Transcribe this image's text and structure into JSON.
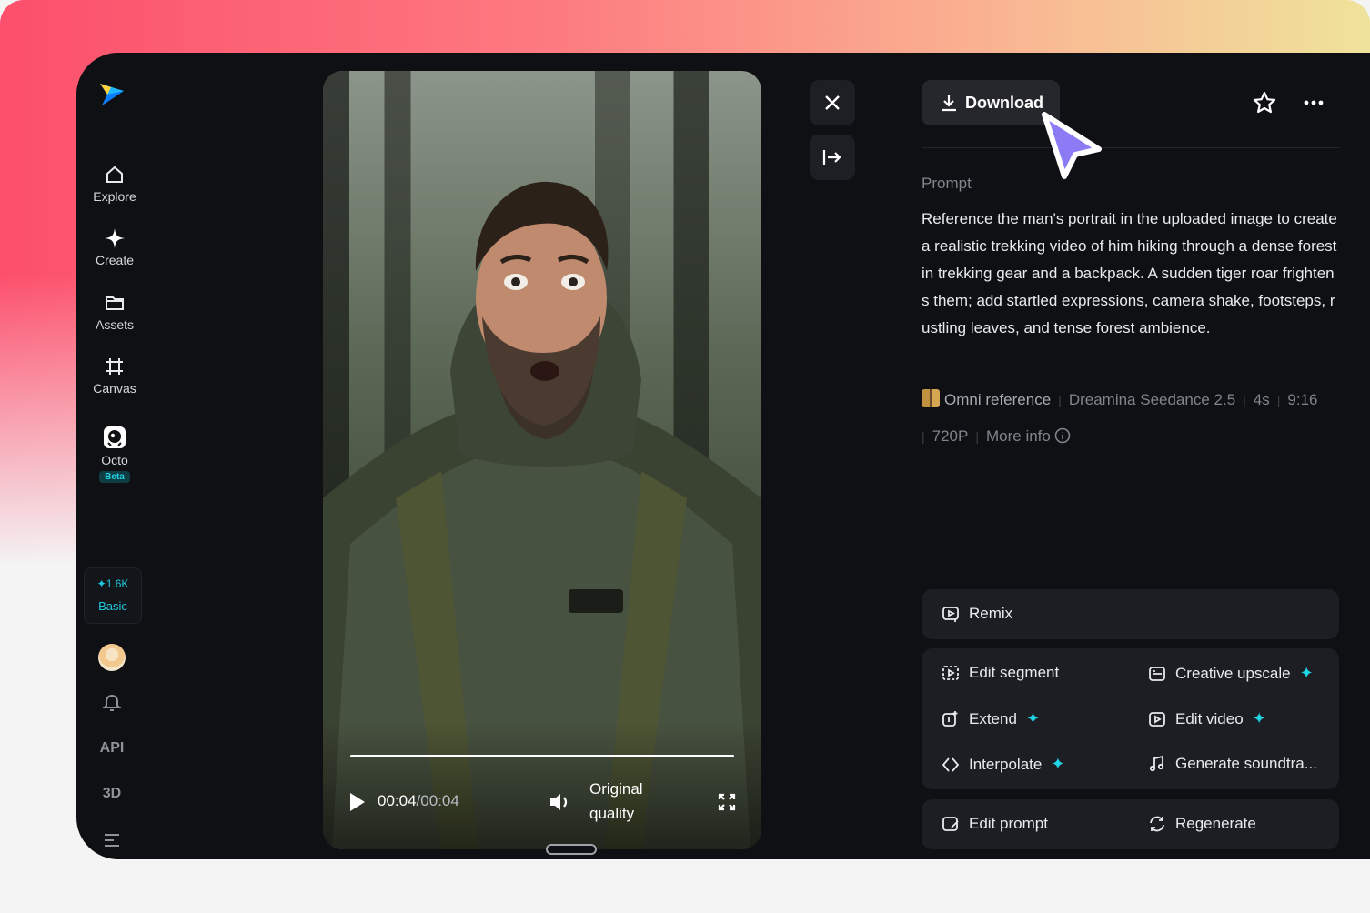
{
  "sidebar": {
    "items": [
      {
        "label": "Explore"
      },
      {
        "label": "Create"
      },
      {
        "label": "Assets"
      },
      {
        "label": "Canvas"
      },
      {
        "label": "Octo",
        "badge": "Beta"
      }
    ],
    "credits": {
      "amount": "1.6K",
      "plan": "Basic"
    },
    "api_label": "API",
    "three_d_label": "3D"
  },
  "player": {
    "current_time": "00:04",
    "separator": "/",
    "duration": "00:04",
    "quality": "Original quality",
    "progress": 1.0
  },
  "panel": {
    "download_label": "Download",
    "prompt_label": "Prompt",
    "prompt_text": "Reference the man's portrait in the uploaded image to create a realistic trekking video of him hiking through a dense forest in trekking gear and a backpack. A sudden tiger roar frightens them; add startled expressions, camera shake, footsteps, rustling leaves, and tense forest ambience.",
    "meta": {
      "reference": "Omni reference",
      "model": "Dreamina Seedance 2.5",
      "duration": "4s",
      "ratio": "9:16",
      "resolution": "720P",
      "more_info": "More info"
    },
    "actions": {
      "remix": "Remix",
      "edit_segment": "Edit segment",
      "creative_upscale": "Creative upscale",
      "extend": "Extend",
      "edit_video": "Edit video",
      "interpolate": "Interpolate",
      "generate_soundtrack": "Generate soundtra...",
      "edit_prompt": "Edit prompt",
      "regenerate": "Regenerate"
    }
  },
  "colors": {
    "accent": "#20d4e6",
    "background": "#0f1013",
    "card": "#1c1e23",
    "cursor": "#8b7cf6"
  }
}
